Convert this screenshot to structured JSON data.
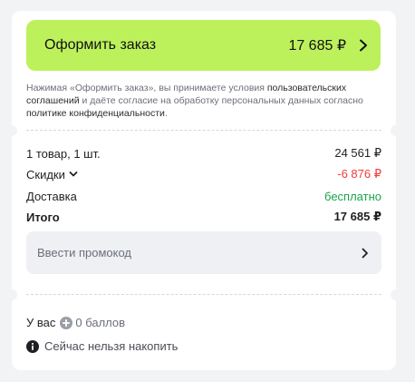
{
  "checkout": {
    "label": "Оформить заказ",
    "total": "17 685 ₽"
  },
  "legal": {
    "prefix": "Нажимая «Оформить заказ», вы принимаете условия ",
    "link_terms": "пользовательских соглашений",
    "middle": " и даёте согласие на обработку персональных данных согласно ",
    "link_privacy": "политике конфиденциальности",
    "suffix": "."
  },
  "summary": {
    "items_label": "1 товар, 1 шт.",
    "items_value": "24 561 ₽",
    "discounts_label": "Скидки",
    "discounts_value": "-6 876 ₽",
    "delivery_label": "Доставка",
    "delivery_value": "бесплатно",
    "total_label": "Итого",
    "total_value": "17 685 ₽"
  },
  "promo": {
    "placeholder": "Ввести промокод"
  },
  "loyalty": {
    "have_label": "У вас",
    "points": "0 баллов",
    "cannot_accrue": "Сейчас нельзя накопить"
  },
  "colors": {
    "accent": "#bdf15c",
    "discount": "#f03c3c",
    "free": "#1aa34a"
  },
  "icons": [
    "chevron-right-icon",
    "chevron-down-icon",
    "plus-circle-icon",
    "info-icon"
  ]
}
